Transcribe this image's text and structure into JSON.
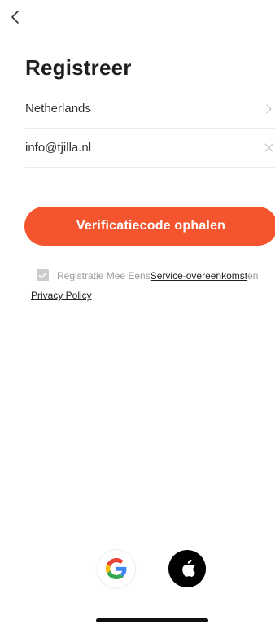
{
  "header": {
    "back_icon": "chevron-left-icon",
    "title": "Registreer"
  },
  "form": {
    "country": {
      "value": "Netherlands",
      "icon": "chevron-right-icon"
    },
    "email": {
      "value": "info@tjilla.nl",
      "icon": "clear-icon"
    }
  },
  "cta": {
    "label": "Verificatiecode ophalen",
    "color": "#f4552e"
  },
  "agreement": {
    "checked": true,
    "prefix": "Registratie Mee Eens",
    "service_link": "Service-overeenkomst",
    "connector": "en",
    "privacy_link": "Privacy Policy"
  },
  "social": {
    "google_icon": "google-icon",
    "apple_icon": "apple-icon"
  }
}
